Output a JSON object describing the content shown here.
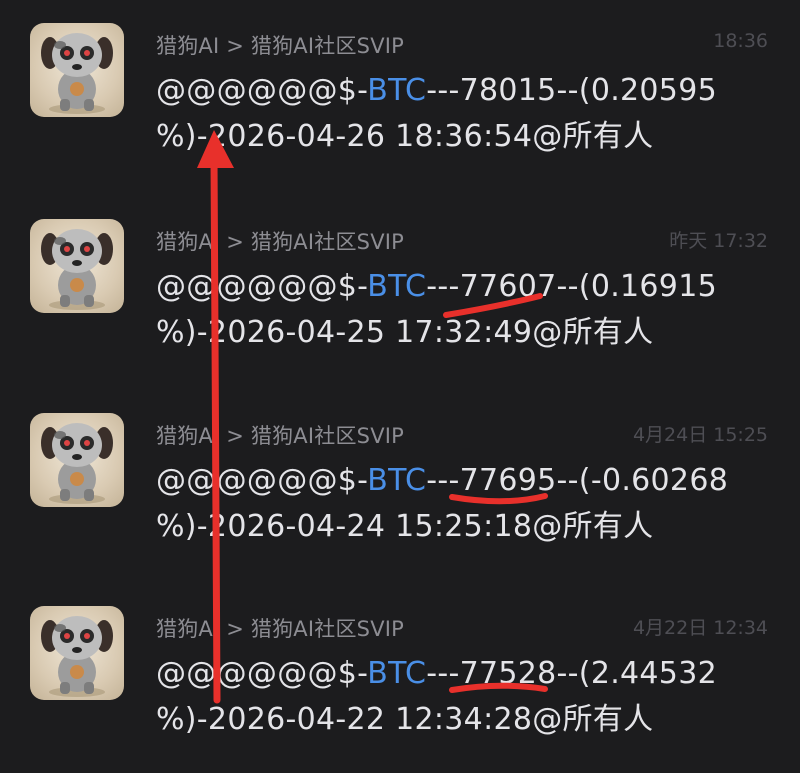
{
  "colors": {
    "background": "#1c1c1e",
    "sender_text": "#8d8d93",
    "time_text": "#4e4e54",
    "body_text": "#e4e4e8",
    "ticker_accent": "#4a8fe7",
    "annotation_red": "#e8302b"
  },
  "messages": [
    {
      "sender": "猎狗AI > 猎狗AI社区SVIP",
      "time": "18:36",
      "prefix": "@@@@@@$-",
      "ticker": "BTC",
      "line1_rest": "---78015--(0.20595",
      "line2": "%)-2026-04-26 18:36:54@所有人",
      "avatar_icon": "robot-dog-avatar-icon"
    },
    {
      "sender": "猎狗AI > 猎狗AI社区SVIP",
      "time": "昨天 17:32",
      "prefix": "@@@@@@$-",
      "ticker": "BTC",
      "line1_rest": "---77607--(0.16915",
      "line2": "%)-2026-04-25 17:32:49@所有人",
      "avatar_icon": "robot-dog-avatar-icon"
    },
    {
      "sender": "猎狗AI > 猎狗AI社区SVIP",
      "time": "4月24日 15:25",
      "prefix": "@@@@@@$-",
      "ticker": "BTC",
      "line1_rest": "---77695--(-0.60268",
      "line2": "%)-2026-04-24 15:25:18@所有人",
      "avatar_icon": "robot-dog-avatar-icon"
    },
    {
      "sender": "猎狗AI > 猎狗AI社区SVIP",
      "time": "4月22日 12:34",
      "prefix": "@@@@@@$-",
      "ticker": "BTC",
      "line1_rest": "---77528--(2.44532",
      "line2": "%)-2026-04-22 12:34:28@所有人",
      "avatar_icon": "robot-dog-avatar-icon"
    }
  ],
  "annotations": {
    "arrow_icon": "red-up-arrow-icon",
    "underline_icon": "red-underline-icon"
  }
}
